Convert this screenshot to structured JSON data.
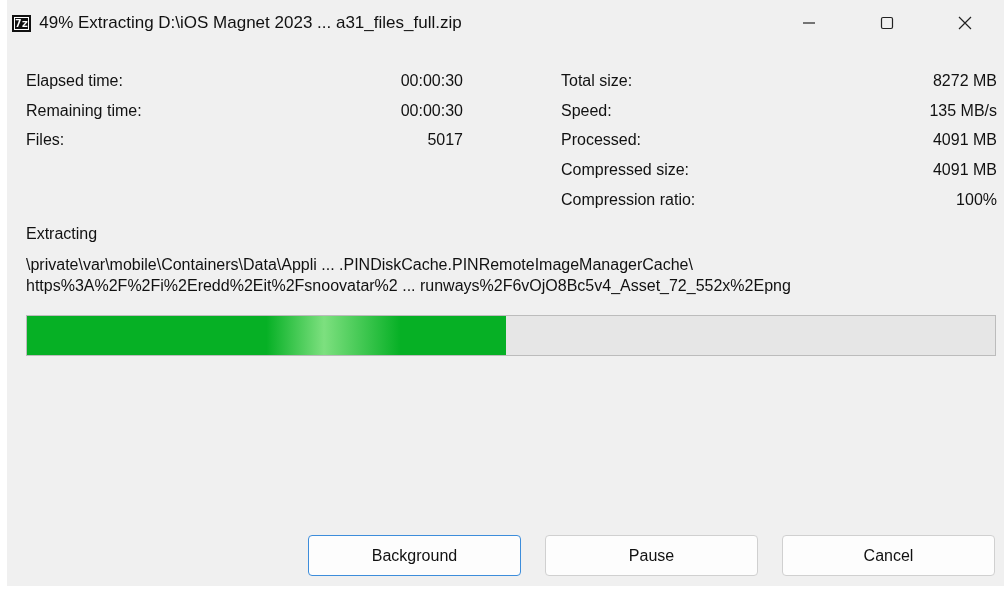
{
  "window": {
    "title": "49% Extracting D:\\iOS Magnet 2023 ... a31_files_full.zip",
    "app_icon": "7z"
  },
  "stats_left": [
    {
      "label": "Elapsed time:",
      "value": "00:00:30"
    },
    {
      "label": "Remaining time:",
      "value": "00:00:30"
    },
    {
      "label": "Files:",
      "value": "5017"
    }
  ],
  "stats_right": [
    {
      "label": "Total size:",
      "value": "8272 MB"
    },
    {
      "label": "Speed:",
      "value": "135 MB/s"
    },
    {
      "label": "Processed:",
      "value": "4091 MB"
    },
    {
      "label": "Compressed size:",
      "value": "4091 MB"
    },
    {
      "label": "Compression ratio:",
      "value": "100%"
    }
  ],
  "operation": "Extracting",
  "paths": [
    "\\private\\var\\mobile\\Containers\\Data\\Appli ... .PINDiskCache.PINRemoteImageManagerCache\\",
    "https%3A%2F%2Fi%2Eredd%2Eit%2Fsnoovatar%2 ... runways%2F6vOjO8Bc5v4_Asset_72_552x%2Epng"
  ],
  "progress": {
    "level": 0.495
  },
  "buttons": [
    {
      "label": "Background",
      "default": true
    },
    {
      "label": "Pause",
      "default": false
    },
    {
      "label": "Cancel",
      "default": false
    }
  ]
}
